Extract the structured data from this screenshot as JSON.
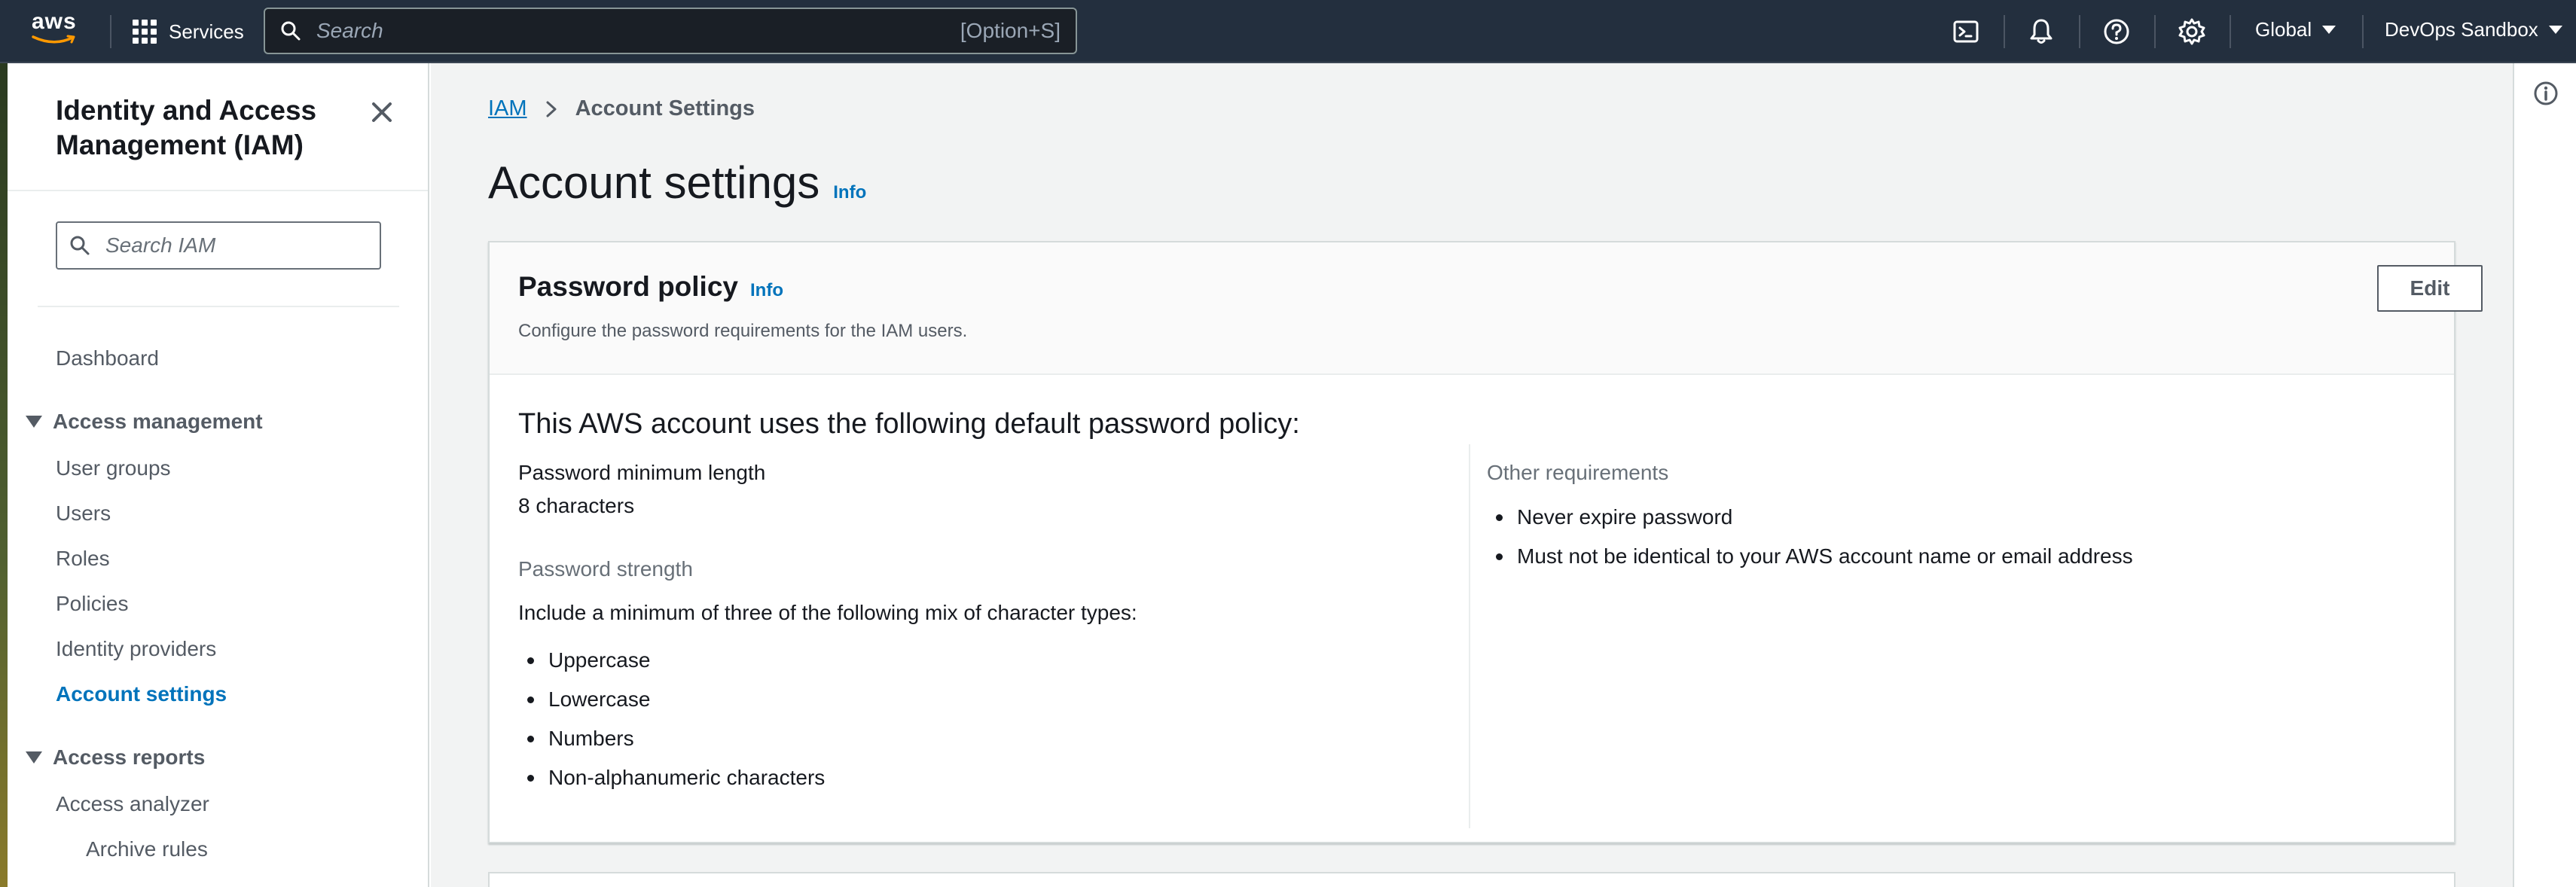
{
  "topbar": {
    "logo_text": "aws",
    "services_label": "Services",
    "search_placeholder": "Search",
    "search_shortcut": "[Option+S]",
    "region_label": "Global",
    "account_label": "DevOps Sandbox",
    "icons": [
      "cloudshell-icon",
      "notifications-bell-icon",
      "help-icon",
      "settings-gear-icon"
    ]
  },
  "sidebar": {
    "title": "Identity and Access Management (IAM)",
    "search_placeholder": "Search IAM",
    "dashboard": "Dashboard",
    "sections": [
      {
        "label": "Access management",
        "items": [
          "User groups",
          "Users",
          "Roles",
          "Policies",
          "Identity providers",
          "Account settings"
        ],
        "active": "Account settings"
      },
      {
        "label": "Access reports",
        "items": [
          "Access analyzer",
          "Archive rules"
        ]
      }
    ]
  },
  "main": {
    "breadcrumb": {
      "root": "IAM",
      "current": "Account Settings"
    },
    "title": "Account settings",
    "info_label": "Info",
    "password_policy": {
      "title": "Password policy",
      "info_label": "Info",
      "description": "Configure the password requirements for the IAM users.",
      "edit_label": "Edit",
      "heading": "This AWS account uses the following default password policy:",
      "min_length_label": "Password minimum length",
      "min_length_value": "8 characters",
      "strength_label": "Password strength",
      "strength_desc": "Include a minimum of three of the following mix of character types:",
      "char_types": [
        "Uppercase",
        "Lowercase",
        "Numbers",
        "Non-alphanumeric characters"
      ],
      "other_label": "Other requirements",
      "other_items": [
        "Never expire password",
        "Must not be identical to your AWS account name or email address"
      ]
    }
  },
  "colors": {
    "topbar_bg": "#232f3e",
    "link": "#0073bb",
    "page_bg": "#f2f3f3",
    "text": "#16191f",
    "muted": "#545b64"
  }
}
